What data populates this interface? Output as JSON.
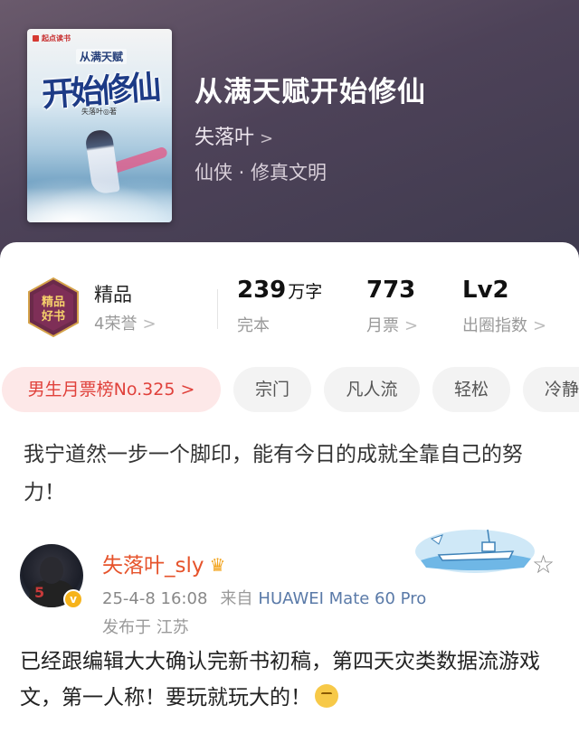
{
  "book": {
    "cover_publisher": "起点读书",
    "cover_subtitle": "从满天赋",
    "cover_main_title": "开始修仙",
    "cover_author": "失落叶◎著",
    "title": "从满天赋开始修仙",
    "author": "失落叶",
    "genre": "仙侠 · 修真文明"
  },
  "stats": {
    "quality_label": "精品",
    "quality_honors": "4荣誉",
    "badge_text": "精品好书",
    "word_count": "239",
    "word_unit": "万字",
    "status": "完本",
    "monthly_tickets": "773",
    "monthly_tickets_label": "月票",
    "level": "Lv2",
    "level_label": "出圈指数"
  },
  "tags": [
    "男生月票榜No.325 >",
    "宗门",
    "凡人流",
    "轻松",
    "冷静"
  ],
  "intro": "我宁道然一步一个脚印，能有今日的成就全靠自己的努力！",
  "post": {
    "user": "失落叶_sly",
    "date": "25-4-8 16:08",
    "source_prefix": "来自",
    "device": "HUAWEI Mate 60 Pro",
    "location": "发布于 江苏",
    "body": "已经跟编辑大大确认完新书初稿，第四天灾类数据流游戏文，第一人称！要玩就玩大的！",
    "avatar_number": "5",
    "v_badge": "v"
  },
  "icons": {
    "chevron": "chevron-right-icon",
    "star": "star-icon",
    "crown": "crown-icon"
  },
  "colors": {
    "header_bg": "#4d4258",
    "rank_tag_bg": "#fde8e8",
    "rank_tag_text": "#e0413b",
    "username": "#e6532b",
    "device_link": "#5a7aa8"
  }
}
